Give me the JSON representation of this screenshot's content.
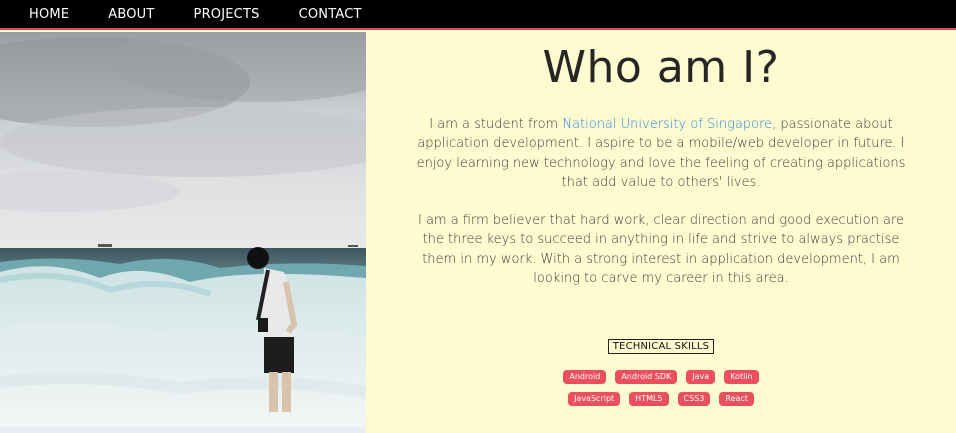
{
  "nav": {
    "items": [
      {
        "label": "HOME"
      },
      {
        "label": "ABOUT"
      },
      {
        "label": "PROJECTS"
      },
      {
        "label": "CONTACT"
      }
    ]
  },
  "colors": {
    "nav_background": "#000000",
    "nav_border": "#e84855",
    "content_background": "#fffbd0",
    "link": "#1e88e5",
    "badge": "#e94f5c"
  },
  "about": {
    "heading": "Who am I?",
    "para1_before": "I am a student from ",
    "para1_link": "National University of Singapore",
    "para1_after": ", passionate about application development. I aspire to be a mobile/web developer in future. I enjoy learning new technology and love the feeling of creating applications that add value to others' lives.",
    "para2": "I am a firm believer that hard work, clear direction and good execution are the three keys to succeed in anything in life and strive to always practise them in my work. With a strong interest in application development, I am looking to carve my career in this area."
  },
  "skills": {
    "title": "TECHNICAL SKILLS",
    "row1": [
      "Android",
      "Android SDK",
      "Java",
      "Kotlin"
    ],
    "row2": [
      "JavaScript",
      "HTML5",
      "CSS3",
      "React"
    ]
  }
}
